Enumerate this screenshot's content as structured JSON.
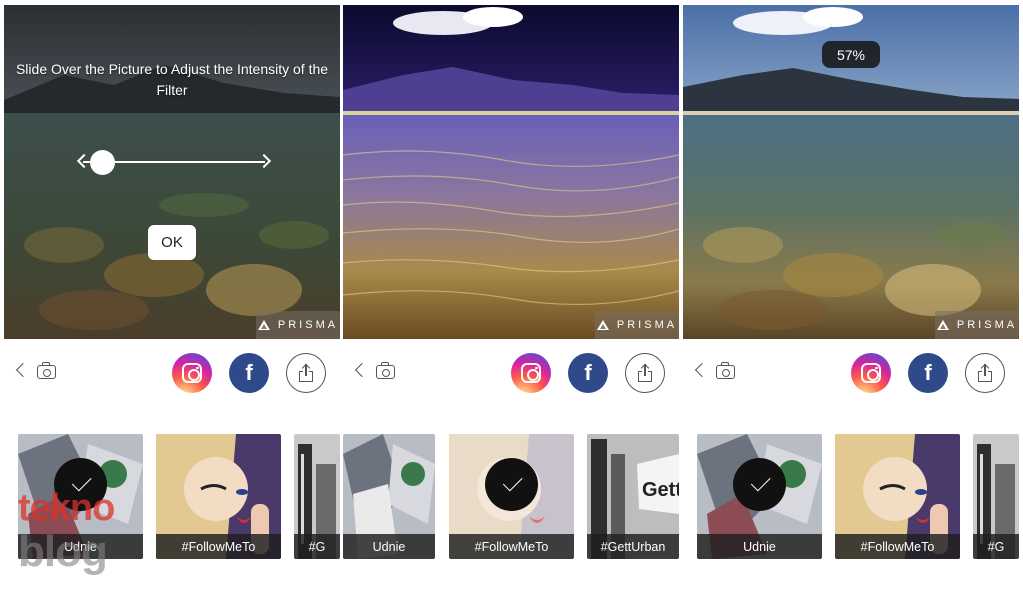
{
  "brand_badge": "PRISMA",
  "panels": [
    {
      "overlay_hint": "Slide Over the Picture to Adjust the Intensity of the Filter",
      "ok_label": "OK",
      "filters": [
        {
          "label": "Udnie",
          "selected": true
        },
        {
          "label": "#FollowMeTo",
          "selected": false
        },
        {
          "label": "#G",
          "selected": false
        }
      ]
    },
    {
      "filters": [
        {
          "label": "Udnie",
          "selected": false
        },
        {
          "label": "#FollowMeTo",
          "selected": true
        },
        {
          "label": "#GettUrban",
          "selected": false
        }
      ]
    },
    {
      "intensity": "57%",
      "filters": [
        {
          "label": "Udnie",
          "selected": true
        },
        {
          "label": "#FollowMeTo",
          "selected": false
        },
        {
          "label": "#G",
          "selected": false
        }
      ]
    }
  ],
  "toolbar": {
    "back": "chevron-left-icon",
    "camera": "camera-icon",
    "instagram": "instagram-icon",
    "facebook": "f",
    "share": "share-icon"
  },
  "watermark": {
    "line1": "tekno",
    "line2": "blog"
  },
  "colors": {
    "facebook": "#2f4a8a",
    "checkmark_bg": "#111111",
    "label_bg": "#1e1e1e"
  }
}
